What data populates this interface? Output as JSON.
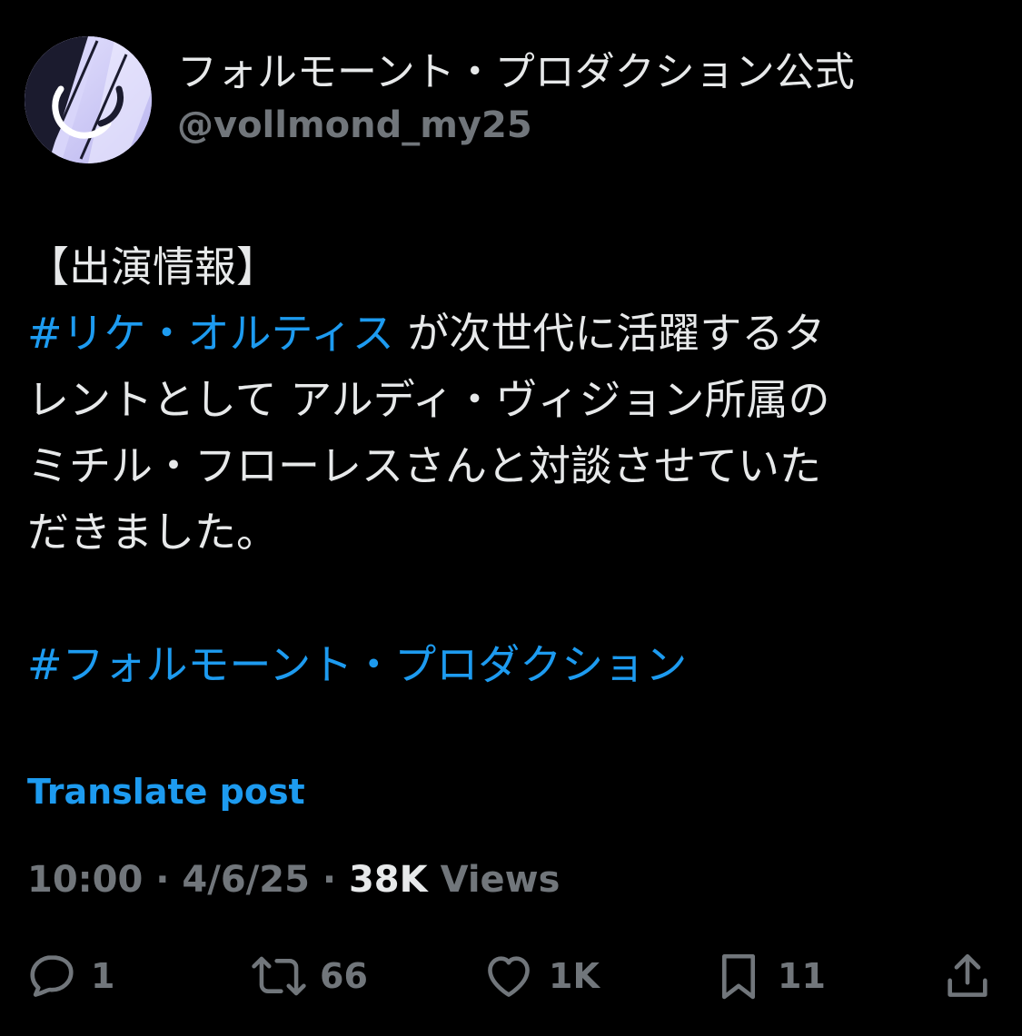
{
  "account": {
    "display_name": "フォルモーント・プロダクション公式",
    "handle": "@vollmond_my25",
    "avatar_icon": "moon-logo-icon"
  },
  "post": {
    "line1": "【出演情報】",
    "line2_hashtag": "#リケ・オルティス",
    "line2_rest": " が次世代に活躍するタ",
    "line3": "レントとして アルディ・ヴィジョン所属の",
    "line4": "ミチル・フローレスさんと対談させていた",
    "line5": "だきました。",
    "hashtag2": "#フォルモーント・プロダクション"
  },
  "translate_label": "Translate post",
  "meta": {
    "time": "10:00",
    "date": "4/6/25",
    "views_count": "38K",
    "views_label": " Views",
    "separator": " · "
  },
  "actions": {
    "reply_count": "1",
    "repost_count": "66",
    "like_count": "1K",
    "bookmark_count": "11"
  },
  "colors": {
    "background": "#000000",
    "text": "#e7e9ea",
    "muted": "#71767b",
    "accent": "#1d9bf0"
  }
}
